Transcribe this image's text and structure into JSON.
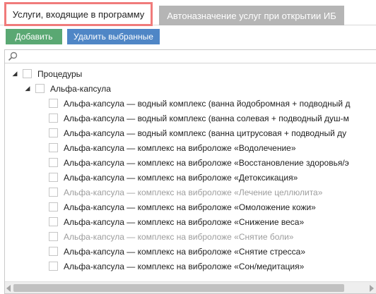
{
  "tabs": {
    "active_label": "Услуги, входящие в программу",
    "inactive_label": "Автоназначение услуг при открытии ИБ",
    "active_border_color": "#f07b7b"
  },
  "toolbar": {
    "add_label": "Добавить",
    "delete_label": "Удалить выбранные",
    "add_color": "#5aa873",
    "delete_color": "#4f86c6"
  },
  "search": {
    "value": "",
    "placeholder": "",
    "icon": "search-icon"
  },
  "tree": {
    "root": {
      "label": "Процедуры",
      "expanded": true,
      "checked": false
    },
    "group": {
      "label": "Альфа-капсула",
      "expanded": true,
      "checked": false
    },
    "items": [
      {
        "label": "Альфа-капсула — водный комплекс (ванна йодобромная + подводный д",
        "disabled": false
      },
      {
        "label": "Альфа-капсула — водный комплекс (ванна солевая + подводный душ-м",
        "disabled": false
      },
      {
        "label": "Альфа-капсула — водный комплекс (ванна цитрусовая + подводный ду",
        "disabled": false
      },
      {
        "label": "Альфа-капсула — комплекс на виброложе «Водолечение»",
        "disabled": false
      },
      {
        "label": "Альфа-капсула — комплекс на виброложе «Восстановление здоровья/э",
        "disabled": false
      },
      {
        "label": "Альфа-капсула — комплекс на виброложе «Детоксикация»",
        "disabled": false
      },
      {
        "label": "Альфа-капсула — комплекс на виброложе «Лечение целлюлита»",
        "disabled": true
      },
      {
        "label": "Альфа-капсула — комплекс на виброложе «Омоложение кожи»",
        "disabled": false
      },
      {
        "label": "Альфа-капсула — комплекс на виброложе «Снижение веса»",
        "disabled": false
      },
      {
        "label": "Альфа-капсула — комплекс на виброложе «Снятие боли»",
        "disabled": true
      },
      {
        "label": "Альфа-капсула — комплекс на виброложе «Снятие стресса»",
        "disabled": false
      },
      {
        "label": "Альфа-капсула — комплекс на виброложе «Сон/медитация»",
        "disabled": false
      }
    ]
  }
}
